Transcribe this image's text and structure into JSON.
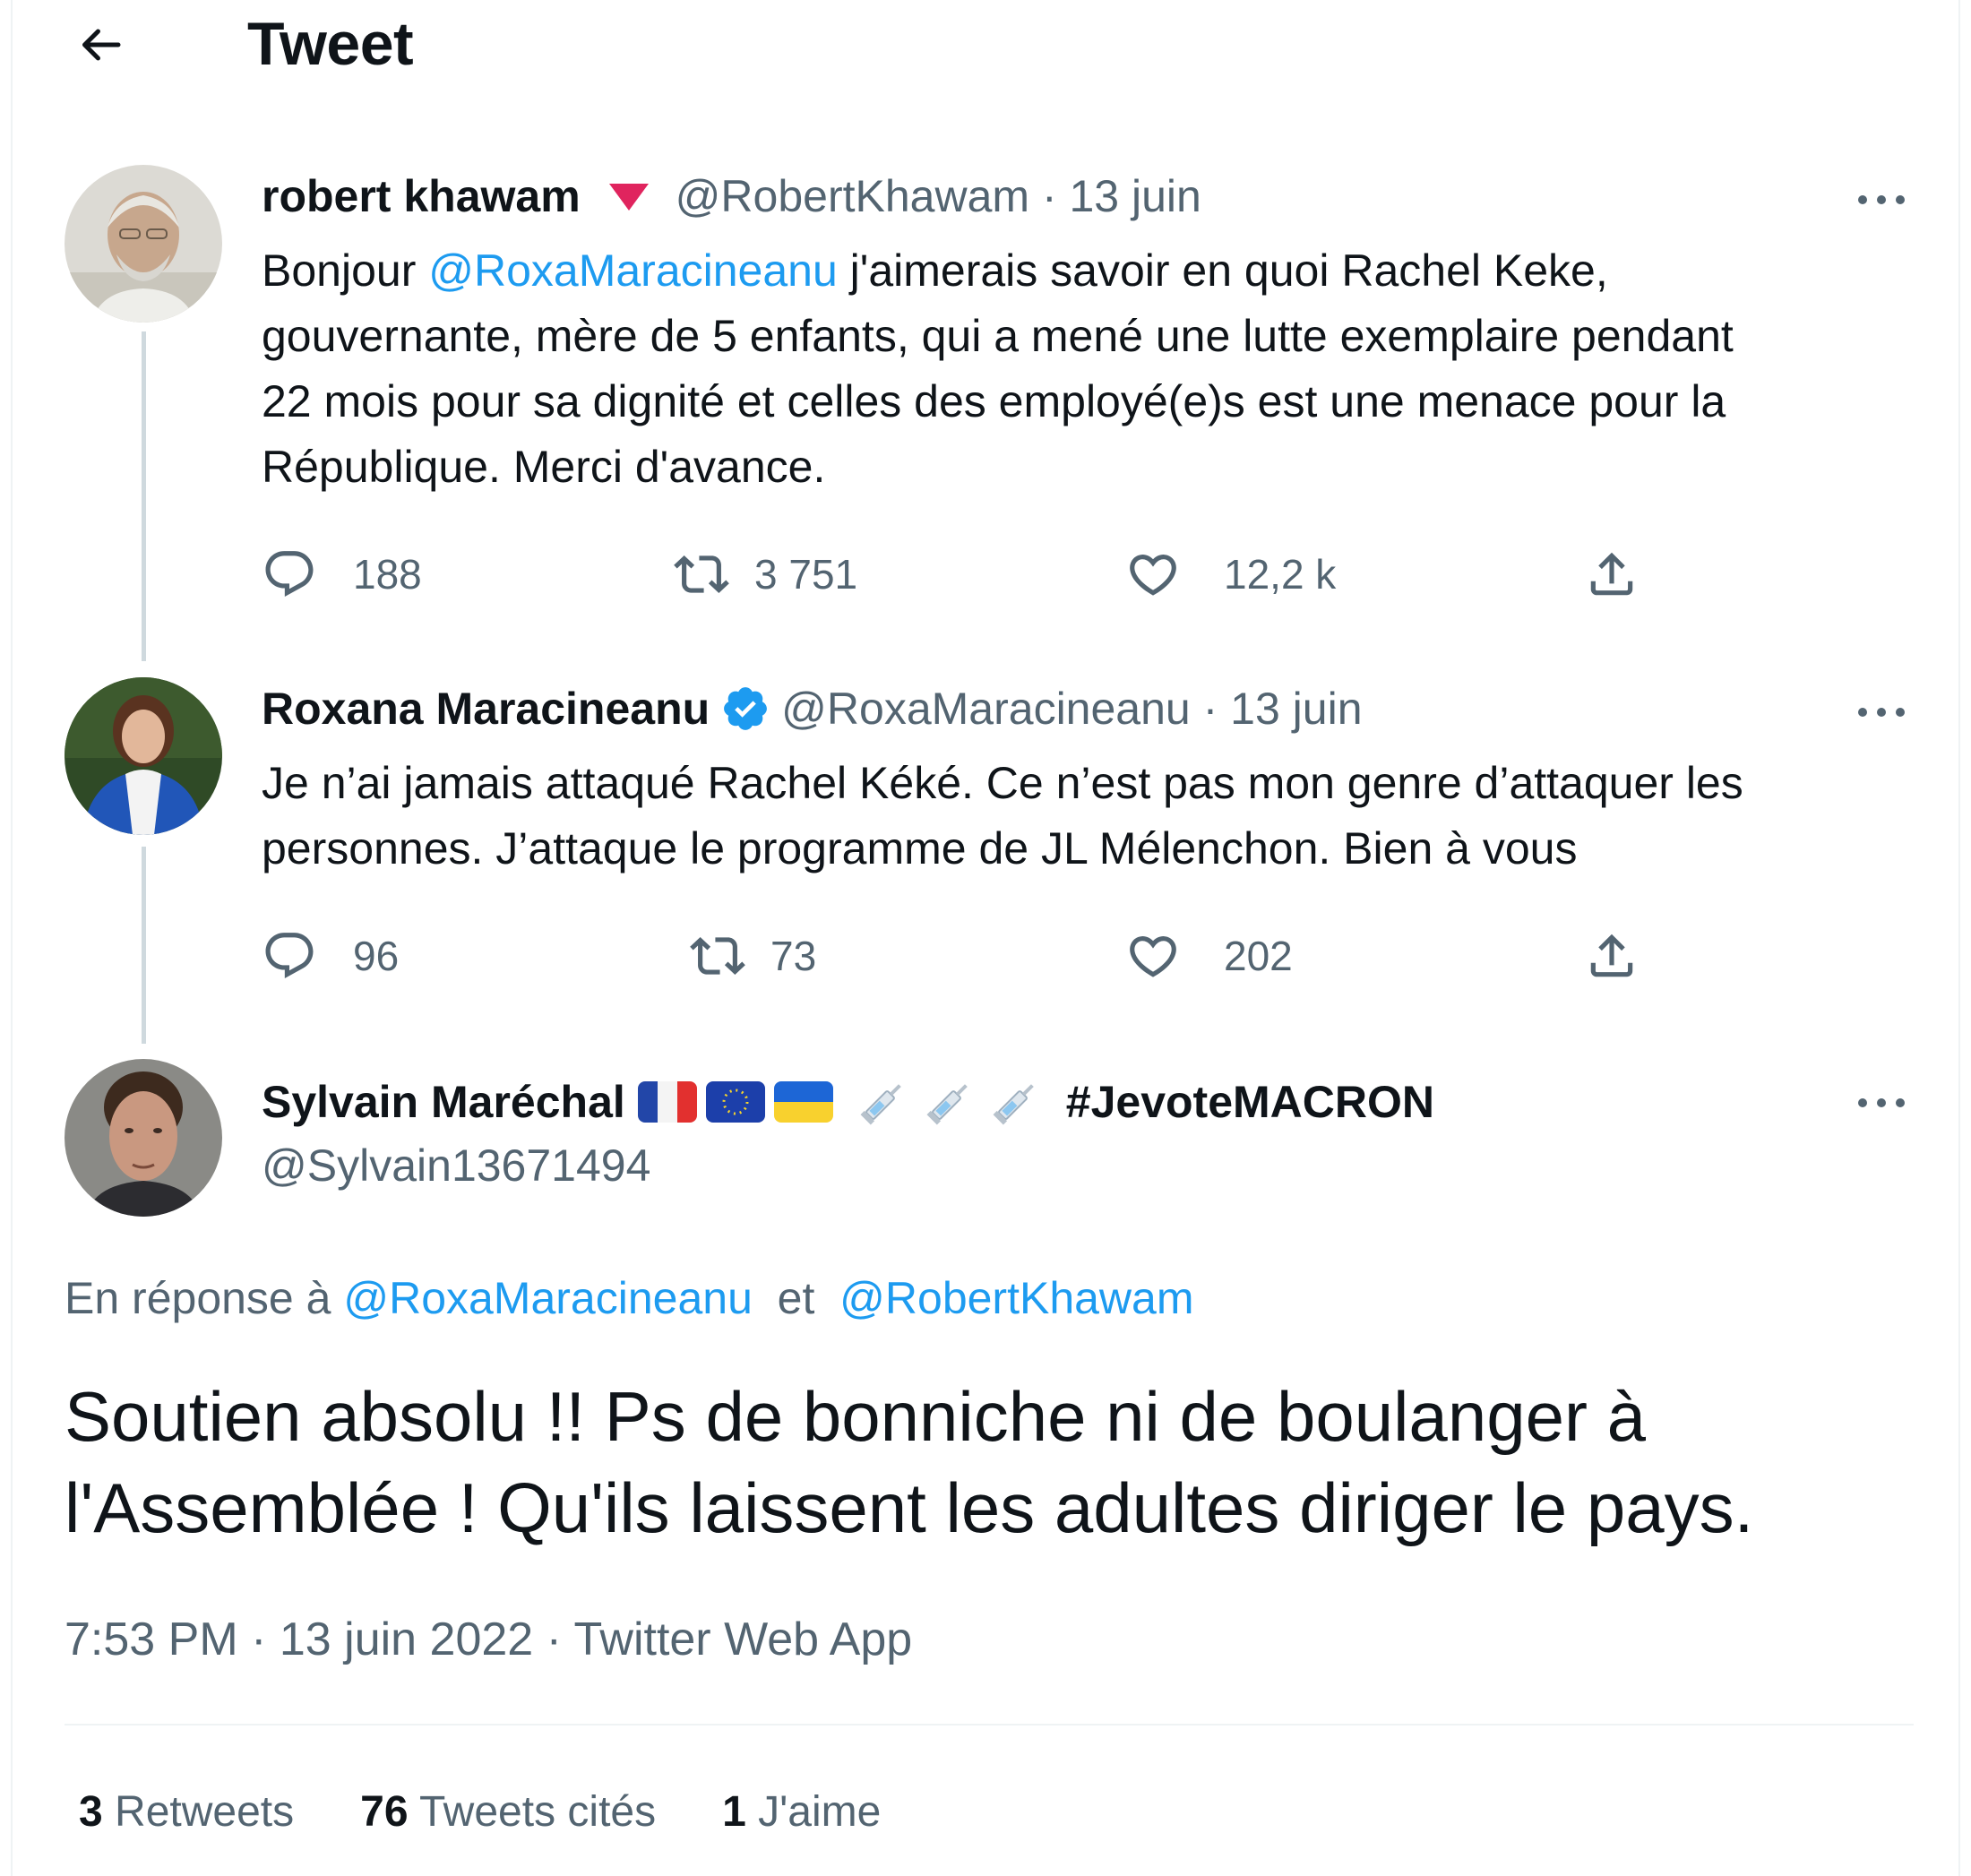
{
  "header": {
    "title": "Tweet"
  },
  "tweets": [
    {
      "name": "robert khawam",
      "handle": "@RobertKhawam",
      "date": "13 juin",
      "text_prefix": "Bonjour ",
      "text_mention": "@RoxaMaracineanu",
      "text_line1_rest": " j'aimerais savoir en quoi Rachel Keke,",
      "text_line2": "gouvernante, mère de 5 enfants, qui a mené une lutte exemplaire pendant",
      "text_line3": "22 mois pour sa dignité et celles des employé(e)s est une menace pour la",
      "text_line4": "République. Merci d'avance.",
      "replies": "188",
      "retweets": "3 751",
      "likes": "12,2 k"
    },
    {
      "name": "Roxana Maracineanu",
      "handle": "@RoxaMaracineanu",
      "date": "13 juin",
      "text_line1": "Je n’ai jamais attaqué Rachel Kéké. Ce n’est pas mon genre d’attaquer les",
      "text_line2": "personnes. J’attaque le programme de JL Mélenchon. Bien à vous",
      "replies": "96",
      "retweets": "73",
      "likes": "202"
    }
  ],
  "main_tweet": {
    "name": "Sylvain Maréchal",
    "hashtag": "#JevoteMACRON",
    "handle": "@Sylvain13671494",
    "reply_label": "En réponse à ",
    "reply_mention1": "@RoxaMaracineanu",
    "reply_and": "  et  ",
    "reply_mention2": "@RobertKhawam",
    "text_line1": "Soutien absolu !! Ps de bonniche ni de boulanger à",
    "text_line2": "l'Assemblée ! Qu'ils laissent les adultes diriger le pays.",
    "meta": "7:53 PM · 13 juin 2022 · Twitter Web App"
  },
  "stats": [
    {
      "count": "3",
      "label": "Retweets"
    },
    {
      "count": "76",
      "label": "Tweets cités"
    },
    {
      "count": "1",
      "label": "J'aime"
    }
  ],
  "icons": {
    "back": "arrow-left-icon",
    "reply": "comment-icon",
    "retweet": "retweet-icon",
    "like": "heart-icon",
    "share": "share-icon",
    "more": "more-dots-icon",
    "verified": "verified-badge-icon",
    "triangle": "red-triangle-icon"
  },
  "colors": {
    "accent": "#1d9bf0",
    "secondary_text": "#536471",
    "thread_line": "#cfd9de",
    "triangle": "#e0245e"
  }
}
